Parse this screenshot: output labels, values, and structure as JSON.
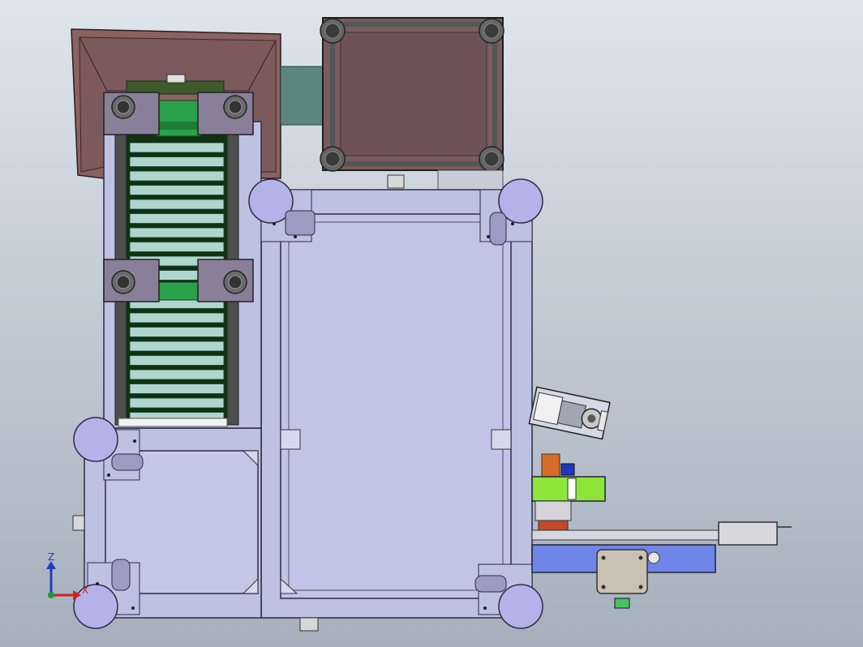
{
  "triad": {
    "z_label": "Z",
    "x_label": "X",
    "z_color": "#1f3fbf",
    "x_color": "#d21e1e",
    "y_color": "#1c9a3a"
  },
  "palette": {
    "frame_fill": "#bdc1e2",
    "frame_stroke": "#2c2c44",
    "hopper_fill": "#8a625f",
    "hopper_inner": "#7c5a5c",
    "bin_fill": "#7b5b5e",
    "bracket_fill": "#8a7f99",
    "caster_disc": "#b3b3ea",
    "roller": "#aed6cc",
    "conveyor_bg": "#0f3310",
    "green_belt": "#2aa14a",
    "lime_plate": "#8de53a",
    "blue_rail": "#6f86e8",
    "teal_duct": "#5b8581",
    "tan_plate": "#c9c1b2"
  }
}
